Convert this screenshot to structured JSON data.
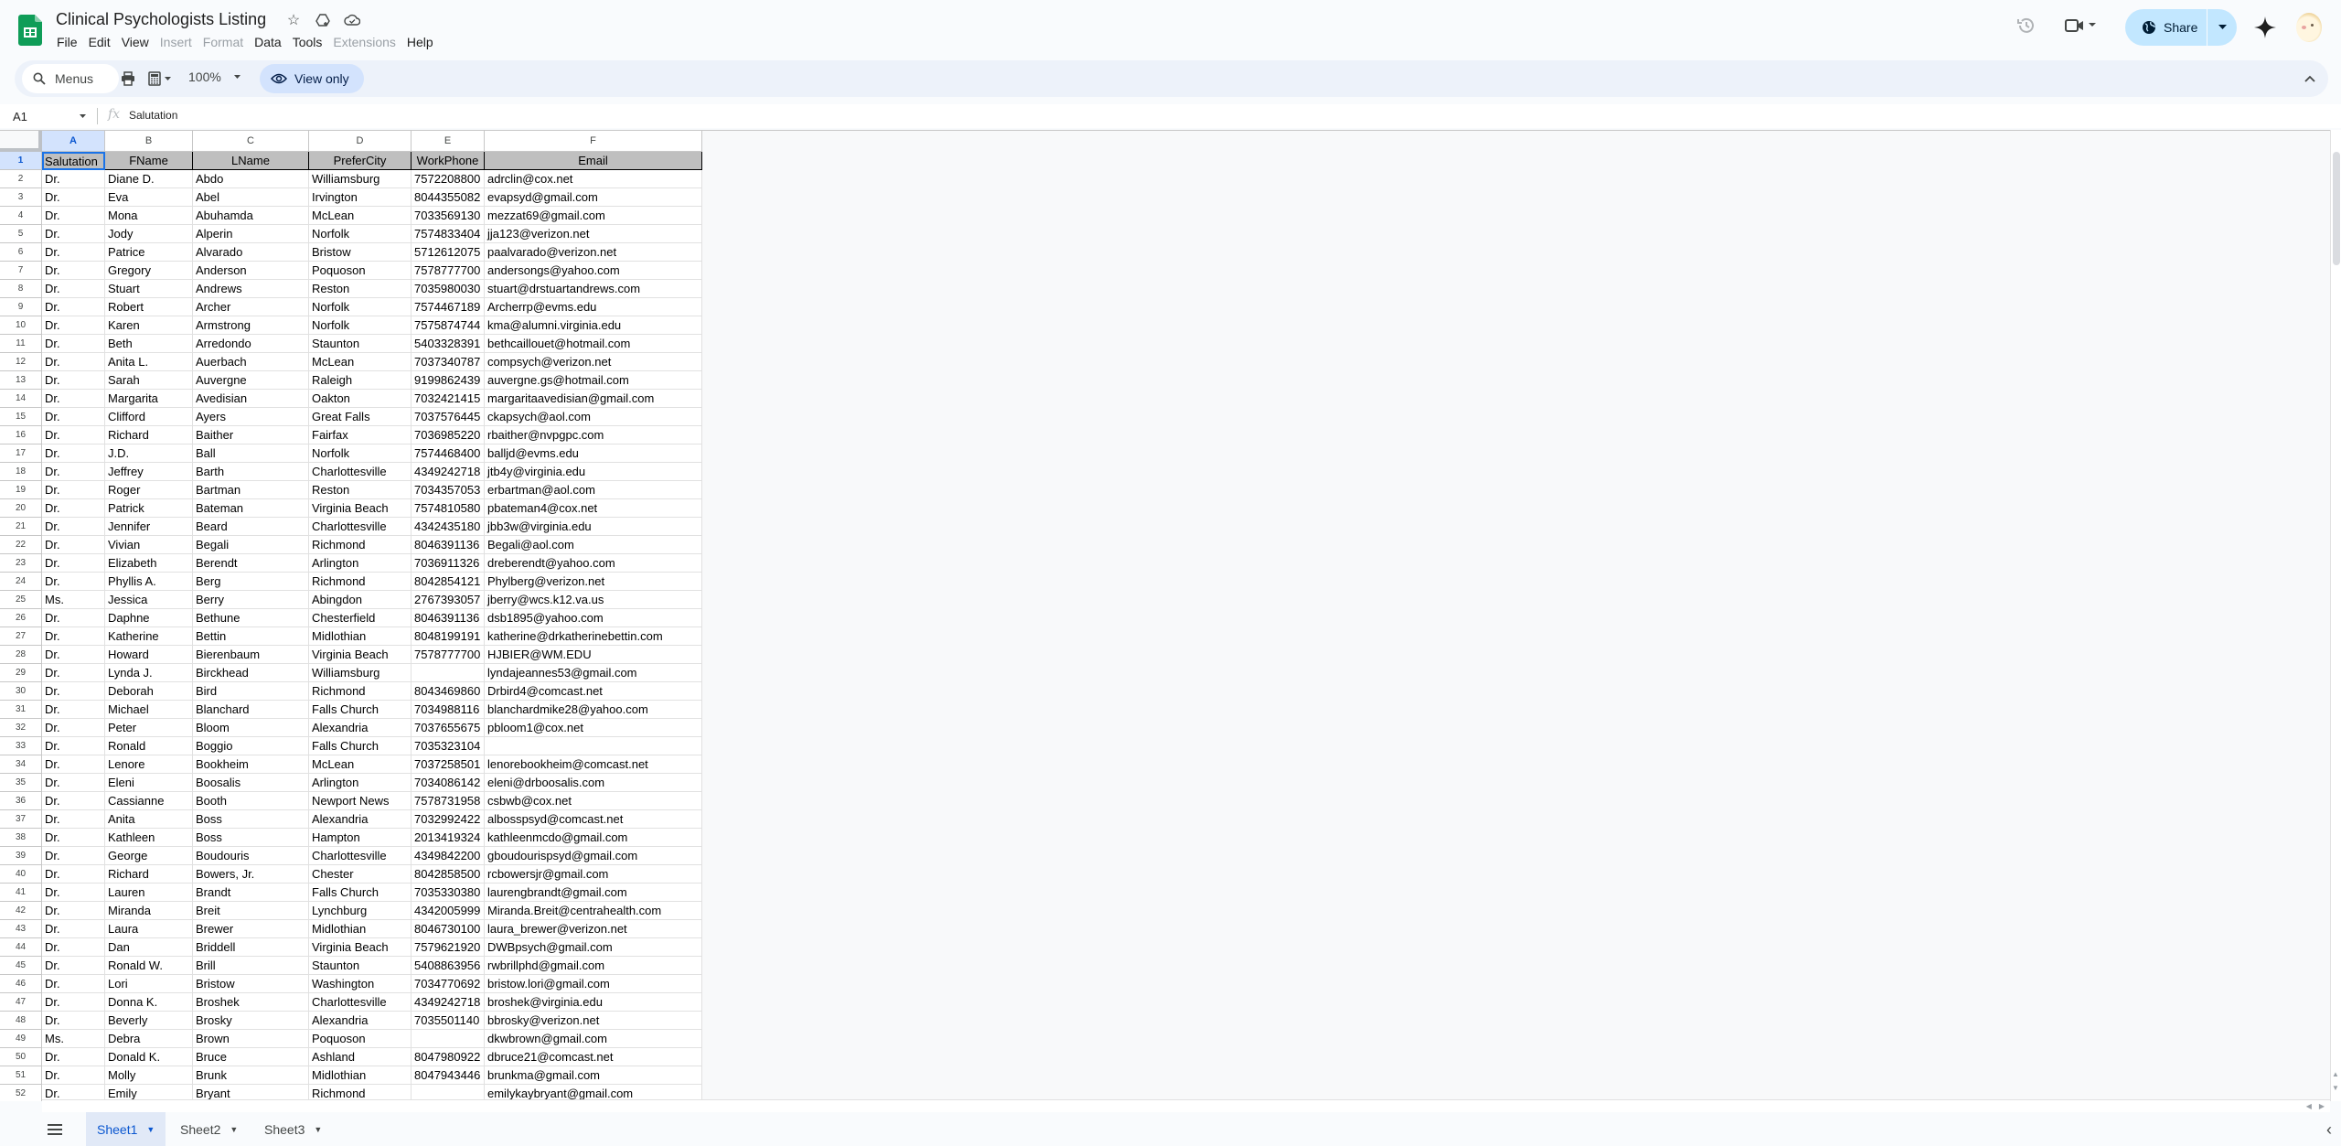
{
  "app": {
    "title": "Clinical Psychologists Listing",
    "menu": [
      {
        "label": "File",
        "enabled": true
      },
      {
        "label": "Edit",
        "enabled": true
      },
      {
        "label": "View",
        "enabled": true
      },
      {
        "label": "Insert",
        "enabled": false
      },
      {
        "label": "Format",
        "enabled": false
      },
      {
        "label": "Data",
        "enabled": true
      },
      {
        "label": "Tools",
        "enabled": true
      },
      {
        "label": "Extensions",
        "enabled": false
      },
      {
        "label": "Help",
        "enabled": true
      }
    ],
    "share_label": "Share",
    "accent_color": "#0b57d0",
    "share_color": "#c2e7ff"
  },
  "toolbar": {
    "menus_label": "Menus",
    "zoom": "100%",
    "view_only_label": "View only"
  },
  "formula_bar": {
    "cell_ref": "A1",
    "value": "Salutation"
  },
  "sheet": {
    "columns": [
      "A",
      "B",
      "C",
      "D",
      "E",
      "F"
    ],
    "selected_column": "A",
    "selected_row": 1,
    "header": [
      "Salutation",
      "FName",
      "LName",
      "PreferCity",
      "WorkPhone",
      "Email"
    ],
    "rows": [
      [
        "Dr.",
        "Diane D.",
        "Abdo",
        "Williamsburg",
        "7572208800",
        "adrclin@cox.net"
      ],
      [
        "Dr.",
        "Eva",
        "Abel",
        "Irvington",
        "8044355082",
        "evapsyd@gmail.com"
      ],
      [
        "Dr.",
        "Mona",
        "Abuhamda",
        "McLean",
        "7033569130",
        "mezzat69@gmail.com"
      ],
      [
        "Dr.",
        "Jody",
        "Alperin",
        "Norfolk",
        "7574833404",
        "jja123@verizon.net"
      ],
      [
        "Dr.",
        "Patrice",
        "Alvarado",
        "Bristow",
        "5712612075",
        "paalvarado@verizon.net"
      ],
      [
        "Dr.",
        "Gregory",
        "Anderson",
        "Poquoson",
        "7578777700",
        "andersongs@yahoo.com"
      ],
      [
        "Dr.",
        "Stuart",
        "Andrews",
        "Reston",
        "7035980030",
        "stuart@drstuartandrews.com"
      ],
      [
        "Dr.",
        "Robert",
        "Archer",
        "Norfolk",
        "7574467189",
        "Archerrp@evms.edu"
      ],
      [
        "Dr.",
        "Karen",
        "Armstrong",
        "Norfolk",
        "7575874744",
        "kma@alumni.virginia.edu"
      ],
      [
        "Dr.",
        "Beth",
        "Arredondo",
        "Staunton",
        "5403328391",
        "bethcaillouet@hotmail.com"
      ],
      [
        "Dr.",
        "Anita L.",
        "Auerbach",
        "McLean",
        "7037340787",
        "compsych@verizon.net"
      ],
      [
        "Dr.",
        "Sarah",
        "Auvergne",
        "Raleigh",
        "9199862439",
        "auvergne.gs@hotmail.com"
      ],
      [
        "Dr.",
        "Margarita",
        "Avedisian",
        "Oakton",
        "7032421415",
        "margaritaavedisian@gmail.com"
      ],
      [
        "Dr.",
        "Clifford",
        "Ayers",
        "Great Falls",
        "7037576445",
        "ckapsych@aol.com"
      ],
      [
        "Dr.",
        "Richard",
        "Baither",
        "Fairfax",
        "7036985220",
        "rbaither@nvpgpc.com"
      ],
      [
        "Dr.",
        "J.D.",
        "Ball",
        "Norfolk",
        "7574468400",
        "balljd@evms.edu"
      ],
      [
        "Dr.",
        "Jeffrey",
        "Barth",
        "Charlottesville",
        "4349242718",
        "jtb4y@virginia.edu"
      ],
      [
        "Dr.",
        "Roger",
        "Bartman",
        "Reston",
        "7034357053",
        "erbartman@aol.com"
      ],
      [
        "Dr.",
        "Patrick",
        "Bateman",
        "Virginia Beach",
        "7574810580",
        "pbateman4@cox.net"
      ],
      [
        "Dr.",
        "Jennifer",
        "Beard",
        "Charlottesville",
        "4342435180",
        "jbb3w@virginia.edu"
      ],
      [
        "Dr.",
        "Vivian",
        "Begali",
        "Richmond",
        "8046391136",
        "Begali@aol.com"
      ],
      [
        "Dr.",
        "Elizabeth",
        "Berendt",
        "Arlington",
        "7036911326",
        "dreberendt@yahoo.com"
      ],
      [
        "Dr.",
        "Phyllis A.",
        "Berg",
        "Richmond",
        "8042854121",
        "Phylberg@verizon.net"
      ],
      [
        "Ms.",
        "Jessica",
        "Berry",
        "Abingdon",
        "2767393057",
        "jberry@wcs.k12.va.us"
      ],
      [
        "Dr.",
        "Daphne",
        "Bethune",
        "Chesterfield",
        "8046391136",
        "dsb1895@yahoo.com"
      ],
      [
        "Dr.",
        "Katherine",
        "Bettin",
        "Midlothian",
        "8048199191",
        "katherine@drkatherinebettin.com"
      ],
      [
        "Dr.",
        "Howard",
        "Bierenbaum",
        "Virginia Beach",
        "7578777700",
        "HJBIER@WM.EDU"
      ],
      [
        "Dr.",
        "Lynda J.",
        "Birckhead",
        "Williamsburg",
        "",
        "lyndajeannes53@gmail.com"
      ],
      [
        "Dr.",
        "Deborah",
        "Bird",
        "Richmond",
        "8043469860",
        "Drbird4@comcast.net"
      ],
      [
        "Dr.",
        "Michael",
        "Blanchard",
        "Falls Church",
        "7034988116",
        "blanchardmike28@yahoo.com"
      ],
      [
        "Dr.",
        "Peter",
        "Bloom",
        "Alexandria",
        "7037655675",
        "pbloom1@cox.net"
      ],
      [
        "Dr.",
        "Ronald",
        "Boggio",
        "Falls Church",
        "7035323104",
        ""
      ],
      [
        "Dr.",
        "Lenore",
        "Bookheim",
        "McLean",
        "7037258501",
        "lenorebookheim@comcast.net"
      ],
      [
        "Dr.",
        "Eleni",
        "Boosalis",
        "Arlington",
        "7034086142",
        "eleni@drboosalis.com"
      ],
      [
        "Dr.",
        "Cassianne",
        "Booth",
        "Newport News",
        "7578731958",
        "csbwb@cox.net"
      ],
      [
        "Dr.",
        "Anita",
        "Boss",
        "Alexandria",
        "7032992422",
        "albosspsyd@comcast.net"
      ],
      [
        "Dr.",
        "Kathleen",
        "Boss",
        "Hampton",
        "2013419324",
        "kathleenmcdo@gmail.com"
      ],
      [
        "Dr.",
        "George",
        "Boudouris",
        "Charlottesville",
        "4349842200",
        "gboudourispsyd@gmail.com"
      ],
      [
        "Dr.",
        "Richard",
        "Bowers, Jr.",
        "Chester",
        "8042858500",
        "rcbowersjr@gmail.com"
      ],
      [
        "Dr.",
        "Lauren",
        "Brandt",
        "Falls Church",
        "7035330380",
        "laurengbrandt@gmail.com"
      ],
      [
        "Dr.",
        "Miranda",
        "Breit",
        "Lynchburg",
        "4342005999",
        "Miranda.Breit@centrahealth.com"
      ],
      [
        "Dr.",
        "Laura",
        "Brewer",
        "Midlothian",
        "8046730100",
        "laura_brewer@verizon.net"
      ],
      [
        "Dr.",
        "Dan",
        "Briddell",
        "Virginia Beach",
        "7579621920",
        "DWBpsych@gmail.com"
      ],
      [
        "Dr.",
        "Ronald W.",
        "Brill",
        "Staunton",
        "5408863956",
        "rwbrillphd@gmail.com"
      ],
      [
        "Dr.",
        "Lori",
        "Bristow",
        "Washington",
        "7034770692",
        "bristow.lori@gmail.com"
      ],
      [
        "Dr.",
        "Donna K.",
        "Broshek",
        "Charlottesville",
        "4349242718",
        "broshek@virginia.edu"
      ],
      [
        "Dr.",
        "Beverly",
        "Brosky",
        "Alexandria",
        "7035501140",
        "bbrosky@verizon.net"
      ],
      [
        "Ms.",
        "Debra",
        "Brown",
        "Poquoson",
        "",
        "dkwbrown@gmail.com"
      ],
      [
        "Dr.",
        "Donald K.",
        "Bruce",
        "Ashland",
        "8047980922",
        "dbruce21@comcast.net"
      ],
      [
        "Dr.",
        "Molly",
        "Brunk",
        "Midlothian",
        "8047943446",
        "brunkma@gmail.com"
      ],
      [
        "Dr.",
        "Emily",
        "Bryant",
        "Richmond",
        "",
        "emilykaybryant@gmail.com"
      ]
    ]
  },
  "sheet_tabs": [
    {
      "label": "Sheet1",
      "active": true
    },
    {
      "label": "Sheet2",
      "active": false
    },
    {
      "label": "Sheet3",
      "active": false
    }
  ],
  "icons": {
    "logo": "google-sheets-logo",
    "star": "star-icon",
    "move": "move-to-drive-icon",
    "cloud": "cloud-saved-icon",
    "history": "history-icon",
    "meet": "video-call-icon",
    "share": "globe-icon",
    "gemini": "gemini-sparkle-icon",
    "search": "search-icon",
    "print": "print-icon",
    "calc": "calculator-icon",
    "eye": "eye-icon"
  }
}
